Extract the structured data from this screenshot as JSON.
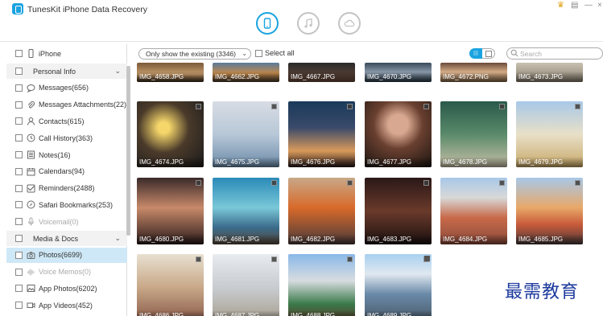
{
  "app": {
    "title": "TunesKit iPhone Data Recovery",
    "accent_color": "#1aa3e0",
    "mode_tabs": [
      {
        "name": "recover-from-ios-device",
        "icon": "phone-icon",
        "active": true
      },
      {
        "name": "recover-from-itunes",
        "icon": "music-note-icon",
        "active": false
      },
      {
        "name": "recover-from-icloud",
        "icon": "cloud-icon",
        "active": false
      }
    ],
    "window_controls": [
      "gift-icon",
      "menu-icon",
      "minimize-icon",
      "close-icon"
    ]
  },
  "sidebar": {
    "device": {
      "label": "iPhone",
      "icon": "phone-icon"
    },
    "items": [
      {
        "type": "section",
        "label": "Personal Info"
      },
      {
        "type": "item",
        "label": "Messages(656)",
        "icon": "message-bubble-icon"
      },
      {
        "type": "item",
        "label": "Messages Attachments(22)",
        "icon": "paperclip-icon"
      },
      {
        "type": "item",
        "label": "Contacts(615)",
        "icon": "contact-person-icon"
      },
      {
        "type": "item",
        "label": "Call History(363)",
        "icon": "clock-icon"
      },
      {
        "type": "item",
        "label": "Notes(16)",
        "icon": "notes-icon"
      },
      {
        "type": "item",
        "label": "Calendars(94)",
        "icon": "calendar-icon"
      },
      {
        "type": "item",
        "label": "Reminders(2488)",
        "icon": "reminder-icon"
      },
      {
        "type": "item",
        "label": "Safari Bookmarks(253)",
        "icon": "compass-icon"
      },
      {
        "type": "item",
        "label": "Voicemail(0)",
        "icon": "microphone-icon",
        "dim": true
      },
      {
        "type": "section",
        "label": "Media & Docs"
      },
      {
        "type": "item",
        "label": "Photos(6699)",
        "icon": "camera-icon",
        "selected": true
      },
      {
        "type": "item",
        "label": "Voice Memos(0)",
        "icon": "waveform-icon",
        "dim": true
      },
      {
        "type": "item",
        "label": "App Photos(6202)",
        "icon": "image-icon"
      },
      {
        "type": "item",
        "label": "App Videos(452)",
        "icon": "video-icon"
      }
    ]
  },
  "toolbar": {
    "filter": "Only show the existing (3346)",
    "select_all": "Select all",
    "search_placeholder": "Search"
  },
  "gallery": {
    "rows": [
      [
        "IMG_4658.JPG",
        "IMG_4662.JPG",
        "IMG_4667.JPG",
        "IMG_4670.JPG",
        "IMG_4672.PNG",
        "IMG_4673.JPG"
      ],
      [
        "IMG_4674.JPG",
        "IMG_4675.JPG",
        "IMG_4676.JPG",
        "IMG_4677.JPG",
        "IMG_4678.JPG",
        "IMG_4679.JPG"
      ],
      [
        "IMG_4680.JPG",
        "IMG_4681.JPG",
        "IMG_4682.JPG",
        "IMG_4683.JPG",
        "IMG_4684.JPG",
        "IMG_4685.JPG"
      ],
      [
        "IMG_4686.JPG",
        "IMG_4687.JPG",
        "IMG_4688.JPG",
        "IMG_4689.JPG"
      ]
    ]
  },
  "watermark": "最需教育"
}
